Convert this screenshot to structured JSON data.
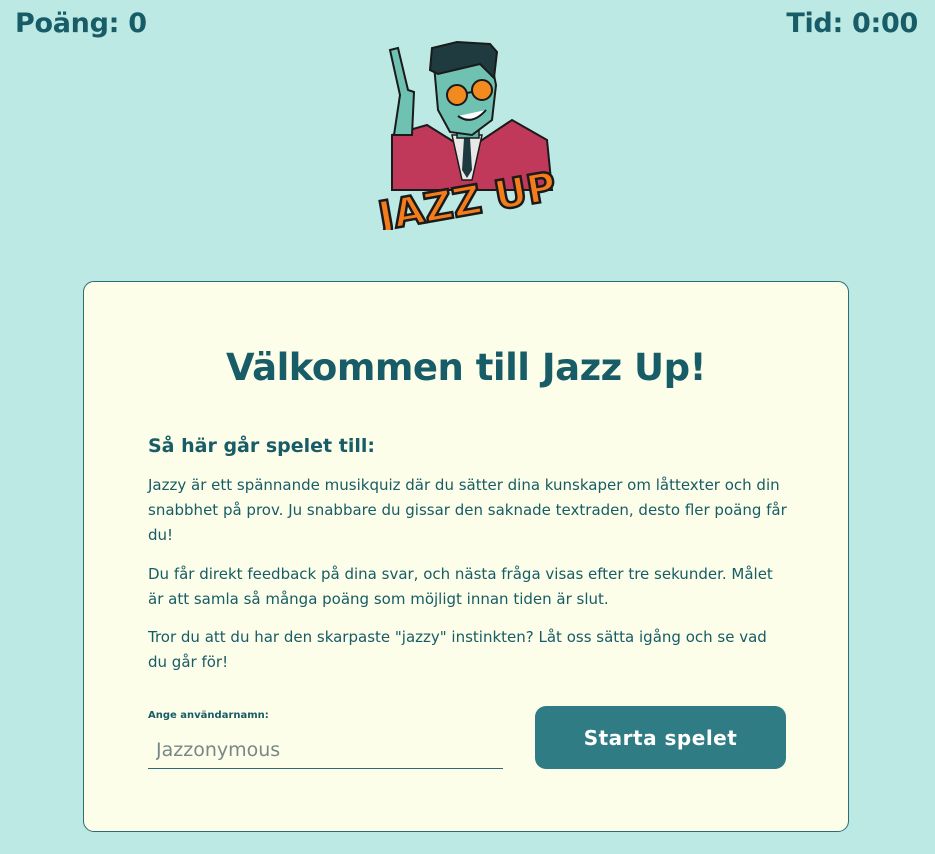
{
  "header": {
    "score": "Poäng: 0",
    "timer": "Tid: 0:00"
  },
  "logo": {
    "text": "JAZZ UP",
    "icon": "jazz-character-logo"
  },
  "card": {
    "title": "Välkommen till Jazz Up!",
    "subtitle": "Så här går spelet till:",
    "paragraphs": [
      "Jazzy är ett spännande musikquiz där du sätter dina kunskaper om låttexter och din snabbhet på prov. Ju snabbare du gissar den saknade textraden, desto fler poäng får du!",
      "Du får direkt feedback på dina svar, och nästa fråga visas efter tre sekunder. Målet är att samla så många poäng som möjligt innan tiden är slut.",
      "Tror du att du har den skarpaste \"jazzy\" instinkten? Låt oss sätta igång och se vad du går för!"
    ],
    "username_label": "Ange användarnamn:",
    "username_placeholder": "Jazzonymous",
    "username_value": "",
    "start_button": "Starta spelet"
  },
  "colors": {
    "background": "#bce9e4",
    "card": "#fcfee9",
    "text": "#175c66",
    "button": "#2f7c85"
  }
}
